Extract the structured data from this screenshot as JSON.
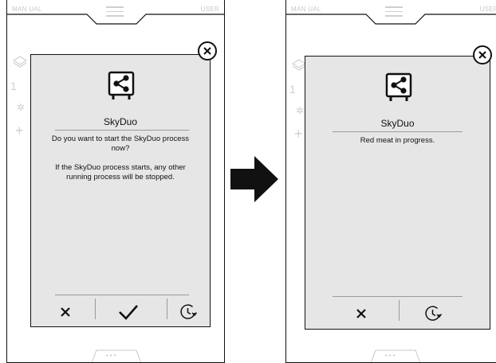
{
  "screens": [
    {
      "topbar": {
        "manual_label": "MAN UAL",
        "user_label": "USER"
      },
      "background_list_number": "1",
      "dialog": {
        "title": "SkyDuo",
        "paragraphs": [
          "Do you want to start the SkyDuo process now?",
          "If the SkyDuo process starts, any other running process will be stopped."
        ],
        "buttons": [
          "cancel",
          "confirm",
          "schedule"
        ]
      }
    },
    {
      "topbar": {
        "manual_label": "MAN UAL",
        "user_label": "USER"
      },
      "background_list_number": "1",
      "dialog": {
        "title": "SkyDuo",
        "paragraphs": [
          "Red meat in progress."
        ],
        "buttons": [
          "cancel",
          "schedule"
        ]
      }
    }
  ],
  "icons": {
    "dialog_icon": "share-nodes-icon",
    "close": "close-circle-icon",
    "cancel": "x-icon",
    "confirm": "checkmark-icon",
    "schedule": "clock-refresh-icon",
    "transition": "right-arrow-icon",
    "menu": "hamburger-menu-icon"
  },
  "colors": {
    "dialog_background": "#e6e6e6",
    "outline": "#111111",
    "ghost_text": "#c8c8c8",
    "separator": "#9a9a9a"
  }
}
